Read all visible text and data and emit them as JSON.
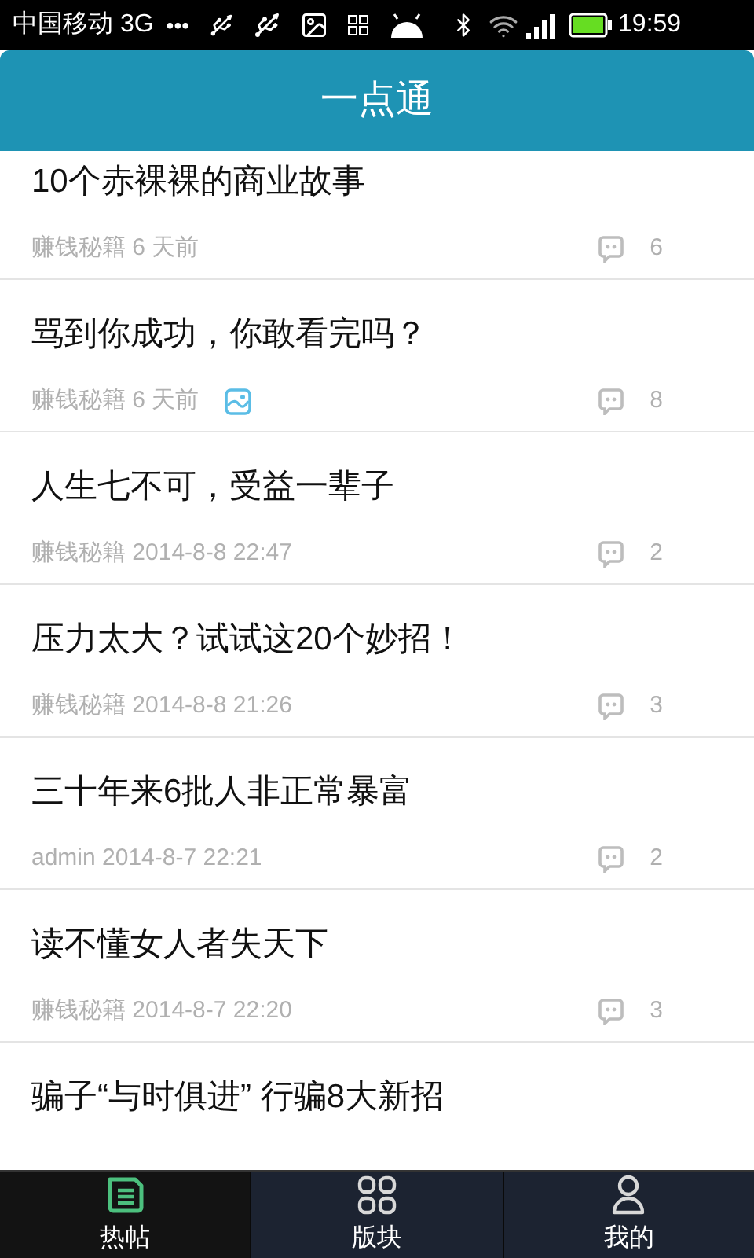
{
  "status_bar": {
    "carrier": "中国移动 3G",
    "dots": "•••",
    "time": "19:59"
  },
  "header": {
    "title": "一点通"
  },
  "posts": [
    {
      "title": "10个赤裸裸的商业故事",
      "author": "赚钱秘籍",
      "time": "6 天前",
      "has_image": false,
      "comments": "6"
    },
    {
      "title": "骂到你成功，你敢看完吗？",
      "author": "赚钱秘籍",
      "time": "6 天前",
      "has_image": true,
      "comments": "8"
    },
    {
      "title": "人生七不可，受益一辈子",
      "author": "赚钱秘籍",
      "time": "2014-8-8 22:47",
      "has_image": false,
      "comments": "2"
    },
    {
      "title": "压力太大？试试这20个妙招！",
      "author": "赚钱秘籍",
      "time": "2014-8-8 21:26",
      "has_image": false,
      "comments": "3"
    },
    {
      "title": "三十年来6批人非正常暴富",
      "author": "admin",
      "time": "2014-8-7 22:21",
      "has_image": false,
      "comments": "2"
    },
    {
      "title": "读不懂女人者失天下",
      "author": "赚钱秘籍",
      "time": "2014-8-7 22:20",
      "has_image": false,
      "comments": "3"
    },
    {
      "title": "骗子“与时俱进” 行骗8大新招"
    }
  ],
  "tabs": [
    {
      "label": "热帖",
      "kind": "posts",
      "selected": true
    },
    {
      "label": "版块",
      "kind": "grid",
      "selected": false
    },
    {
      "label": "我的",
      "kind": "person",
      "selected": false
    }
  ]
}
